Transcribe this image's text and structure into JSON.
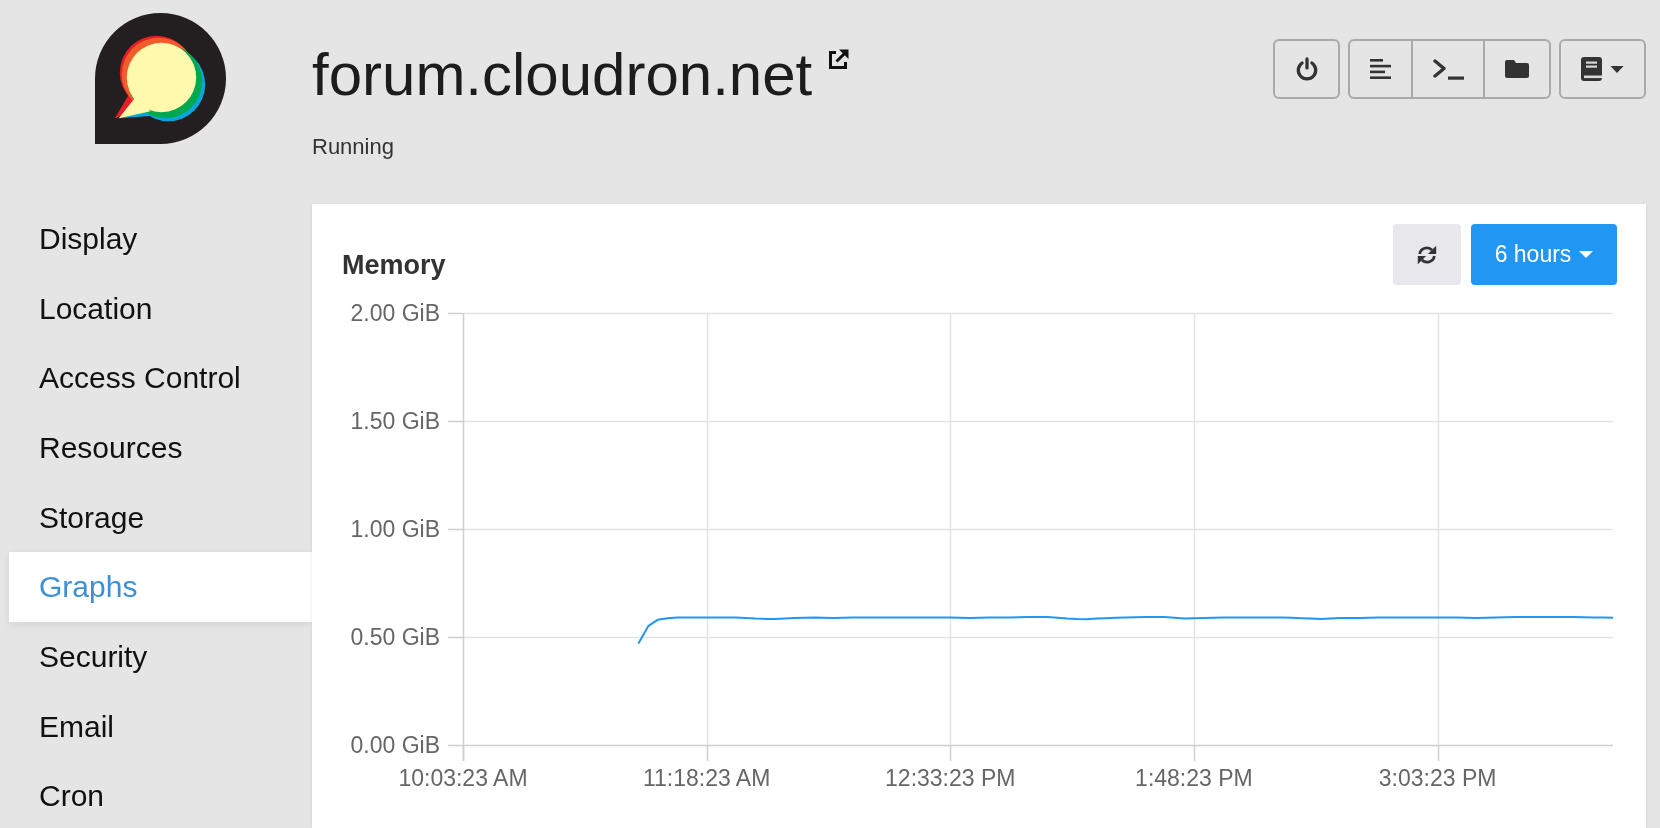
{
  "app": {
    "title": "forum.cloudron.net",
    "status": "Running"
  },
  "sidebar": {
    "items": [
      {
        "label": "Display",
        "selected": false
      },
      {
        "label": "Location",
        "selected": false
      },
      {
        "label": "Access Control",
        "selected": false
      },
      {
        "label": "Resources",
        "selected": false
      },
      {
        "label": "Storage",
        "selected": false
      },
      {
        "label": "Graphs",
        "selected": true
      },
      {
        "label": "Security",
        "selected": false
      },
      {
        "label": "Email",
        "selected": false
      },
      {
        "label": "Cron",
        "selected": false
      }
    ]
  },
  "panel": {
    "range_button": "6 hours",
    "chart_data": {
      "type": "line",
      "title": "Memory",
      "grid": true,
      "categories": [
        "10:03:23 AM",
        null,
        null,
        null,
        null,
        null,
        null,
        null,
        null,
        null,
        null,
        null,
        null,
        null,
        null,
        null,
        null,
        null,
        null,
        null,
        null,
        null,
        null,
        null,
        null,
        "11:18:23 AM",
        null,
        null,
        null,
        null,
        null,
        null,
        null,
        null,
        null,
        null,
        null,
        null,
        null,
        null,
        null,
        null,
        null,
        null,
        null,
        null,
        null,
        null,
        null,
        null,
        "12:33:23 PM",
        null,
        null,
        null,
        null,
        null,
        null,
        null,
        null,
        null,
        null,
        null,
        null,
        null,
        null,
        null,
        null,
        null,
        null,
        null,
        null,
        null,
        null,
        null,
        null,
        "1:48:23 PM",
        null,
        null,
        null,
        null,
        null,
        null,
        null,
        null,
        null,
        null,
        null,
        null,
        null,
        null,
        null,
        null,
        null,
        null,
        null,
        null,
        null,
        null,
        null,
        null,
        "3:03:23 PM",
        null,
        null,
        null,
        null,
        null,
        null,
        null,
        null,
        null,
        null,
        null,
        null,
        null,
        null,
        null,
        null,
        null,
        null
      ],
      "series": [
        {
          "color": "#2196f3",
          "values": [
            null,
            null,
            null,
            null,
            null,
            null,
            null,
            null,
            null,
            null,
            null,
            null,
            null,
            null,
            null,
            null,
            null,
            null,
            0.47,
            0.55,
            0.58,
            0.587,
            0.59,
            0.59,
            0.59,
            0.59,
            0.59,
            0.59,
            0.59,
            0.588,
            0.585,
            0.584,
            0.583,
            0.586,
            0.588,
            0.589,
            0.59,
            0.589,
            0.588,
            0.589,
            0.59,
            0.59,
            0.59,
            0.59,
            0.59,
            0.59,
            0.59,
            0.59,
            0.59,
            0.59,
            0.59,
            0.589,
            0.588,
            0.589,
            0.59,
            0.59,
            0.59,
            0.591,
            0.592,
            0.592,
            0.592,
            0.589,
            0.585,
            0.583,
            0.582,
            0.585,
            0.587,
            0.589,
            0.59,
            0.591,
            0.592,
            0.592,
            0.592,
            0.589,
            0.585,
            0.587,
            0.588,
            0.589,
            0.59,
            0.59,
            0.59,
            0.59,
            0.59,
            0.59,
            0.59,
            0.589,
            0.587,
            0.585,
            0.583,
            0.586,
            0.588,
            0.588,
            0.588,
            0.589,
            0.59,
            0.59,
            0.59,
            0.59,
            0.59,
            0.59,
            0.59,
            0.59,
            0.59,
            0.589,
            0.588,
            0.589,
            0.59,
            0.591,
            0.592,
            0.592,
            0.592,
            0.592,
            0.592,
            0.592,
            0.592,
            0.591,
            0.59,
            0.59,
            0.589
          ]
        }
      ],
      "ylim": [
        0,
        2
      ],
      "yticks": [
        {
          "value": 0,
          "label": "0.00 GiB"
        },
        {
          "value": 0.5,
          "label": "0.50 GiB"
        },
        {
          "value": 1,
          "label": "1.00 GiB"
        },
        {
          "value": 1.5,
          "label": "1.50 GiB"
        },
        {
          "value": 2,
          "label": "2.00 GiB"
        }
      ]
    }
  }
}
